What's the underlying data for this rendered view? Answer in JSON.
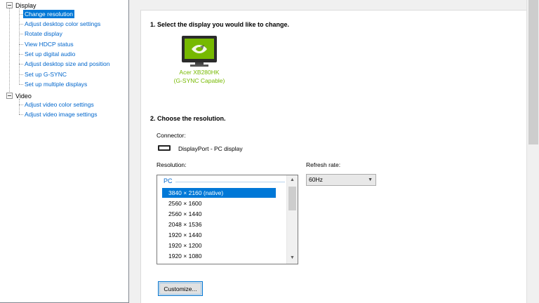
{
  "tree": {
    "categories": [
      {
        "label": "Display",
        "items": [
          "Change resolution",
          "Adjust desktop color settings",
          "Rotate display",
          "View HDCP status",
          "Set up digital audio",
          "Adjust desktop size and position",
          "Set up G-SYNC",
          "Set up multiple displays"
        ]
      },
      {
        "label": "Video",
        "items": [
          "Adjust video color settings",
          "Adjust video image settings"
        ]
      }
    ],
    "selected": "Change resolution"
  },
  "main": {
    "step1": "1. Select the display you would like to change.",
    "display_name": "Acer XB280HK",
    "display_sub": "(G-SYNC Capable)",
    "step2": "2. Choose the resolution.",
    "connector_label": "Connector:",
    "connector_value": "DisplayPort - PC display",
    "resolution_label": "Resolution:",
    "resolution_group": "PC",
    "resolutions": [
      "3840 × 2160 (native)",
      "2560 × 1600",
      "2560 × 1440",
      "2048 × 1536",
      "1920 × 1440",
      "1920 × 1200",
      "1920 × 1080"
    ],
    "selected_resolution": "3840 × 2160 (native)",
    "refresh_label": "Refresh rate:",
    "refresh_value": "60Hz",
    "customize_label": "Customize..."
  },
  "colors": {
    "selection": "#0078d7",
    "link": "#0066cc",
    "nvidia_green": "#76b900"
  },
  "icons": {
    "collapse": "minus-box-icon",
    "monitor": "monitor-icon",
    "connector": "displayport-icon"
  }
}
